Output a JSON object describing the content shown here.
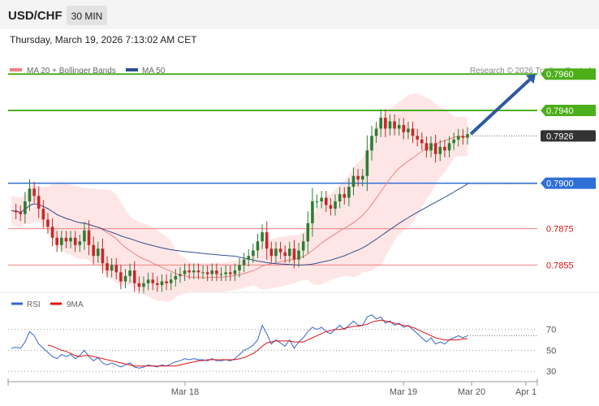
{
  "header": {
    "symbol": "USD/CHF",
    "interval": "30 MIN",
    "datetime": "Thursday, March 19, 2026 7:13:02 AM CET"
  },
  "legend": {
    "ma20_label": "MA 20 + Bollinger Bands",
    "ma50_label": "MA 50",
    "credit": "Research © 2026 Trading Central",
    "rsi_label": "RSI",
    "rsi_ma_label": "9MA"
  },
  "colors": {
    "bull": "#2e7d32",
    "bear": "#c62828",
    "ma20": "#f08080",
    "band_fill": "#ffd6d6",
    "ma50": "#2f4f8f",
    "resistance": "#4caf1a",
    "pivot": "#2f6fd8",
    "support": "#f08080",
    "arrow": "#2d5aa0",
    "rsi": "#3366cc",
    "rsi_ma": "#dd1111",
    "current_price_bg": "#333333"
  },
  "chart_data": [
    {
      "type": "candlestick",
      "title": "USD/CHF",
      "timeframe": "30 MIN",
      "x_tick_labels": [
        "Mar 18",
        "Mar 19",
        "Mar 20",
        "Apr 1"
      ],
      "price_levels": [
        {
          "value": 0.796,
          "label": "0.7960",
          "role": "resistance"
        },
        {
          "value": 0.794,
          "label": "0.7940",
          "role": "resistance"
        },
        {
          "value": 0.7926,
          "label": "0.7926",
          "role": "current"
        },
        {
          "value": 0.79,
          "label": "0.7900",
          "role": "pivot"
        },
        {
          "value": 0.7875,
          "label": "0.7875",
          "role": "support"
        },
        {
          "value": 0.7855,
          "label": "0.7855",
          "role": "support"
        }
      ],
      "closes": [
        0.7885,
        0.7884,
        0.7883,
        0.789,
        0.7897,
        0.7893,
        0.7886,
        0.788,
        0.7876,
        0.787,
        0.7866,
        0.787,
        0.7868,
        0.787,
        0.7866,
        0.7868,
        0.7874,
        0.7866,
        0.786,
        0.7864,
        0.7856,
        0.7852,
        0.7855,
        0.7851,
        0.7846,
        0.7849,
        0.7852,
        0.7845,
        0.7843,
        0.7845,
        0.7847,
        0.7845,
        0.7844,
        0.7846,
        0.7845,
        0.7847,
        0.7849,
        0.785,
        0.7852,
        0.7851,
        0.7852,
        0.7851,
        0.7851,
        0.785,
        0.7852,
        0.785,
        0.785,
        0.7851,
        0.785,
        0.7852,
        0.7855,
        0.7858,
        0.786,
        0.7863,
        0.7868,
        0.7873,
        0.7864,
        0.786,
        0.7864,
        0.7862,
        0.786,
        0.7864,
        0.7858,
        0.7863,
        0.7868,
        0.7878,
        0.789,
        0.789,
        0.7892,
        0.7888,
        0.7886,
        0.789,
        0.7894,
        0.7892,
        0.7898,
        0.7904,
        0.7902,
        0.7904,
        0.7918,
        0.7926,
        0.793,
        0.7936,
        0.793,
        0.7934,
        0.793,
        0.7932,
        0.7928,
        0.793,
        0.7926,
        0.7924,
        0.7922,
        0.7918,
        0.7922,
        0.7916,
        0.792,
        0.7918,
        0.7922,
        0.7924,
        0.7926,
        0.7925,
        0.7927
      ],
      "ma20_last": 0.7922,
      "ma50_last": 0.7897,
      "ylim": [
        0.784,
        0.7965
      ]
    },
    {
      "type": "line",
      "title": "RSI",
      "series": [
        {
          "name": "RSI",
          "values": [
            52,
            53,
            52,
            58,
            68,
            64,
            56,
            52,
            48,
            44,
            42,
            46,
            44,
            46,
            42,
            45,
            50,
            44,
            40,
            43,
            38,
            36,
            38,
            36,
            34,
            36,
            38,
            34,
            33,
            34,
            36,
            35,
            34,
            36,
            35,
            37,
            39,
            40,
            42,
            41,
            42,
            41,
            41,
            40,
            42,
            40,
            40,
            41,
            40,
            42,
            46,
            50,
            52,
            55,
            60,
            74,
            66,
            56,
            60,
            57,
            54,
            60,
            52,
            58,
            62,
            68,
            72,
            70,
            72,
            68,
            66,
            70,
            74,
            70,
            74,
            78,
            74,
            74,
            82,
            84,
            80,
            82,
            76,
            78,
            74,
            76,
            72,
            74,
            70,
            66,
            62,
            58,
            62,
            56,
            58,
            56,
            60,
            62,
            64,
            62,
            64
          ]
        },
        {
          "name": "9MA",
          "values": [
            null,
            null,
            null,
            null,
            null,
            null,
            null,
            null,
            55,
            54,
            52,
            50,
            49,
            47,
            45,
            44,
            45,
            45,
            44,
            43,
            42,
            41,
            40,
            39,
            38,
            37,
            36,
            35,
            35,
            35,
            35,
            35,
            35,
            35,
            35,
            35,
            35,
            36,
            37,
            38,
            39,
            40,
            40,
            41,
            41,
            41,
            41,
            41,
            41,
            41,
            42,
            43,
            45,
            47,
            50,
            54,
            57,
            58,
            59,
            59,
            59,
            59,
            58,
            58,
            58,
            60,
            62,
            64,
            66,
            68,
            69,
            70,
            70,
            71,
            72,
            73,
            73,
            74,
            75,
            77,
            78,
            79,
            78,
            77,
            76,
            75,
            74,
            73,
            72,
            70,
            68,
            66,
            64,
            62,
            61,
            60,
            60,
            60,
            60,
            61,
            61
          ]
        }
      ],
      "ylim": [
        20,
        90
      ],
      "y_ticks": [
        30,
        50,
        70
      ]
    }
  ]
}
